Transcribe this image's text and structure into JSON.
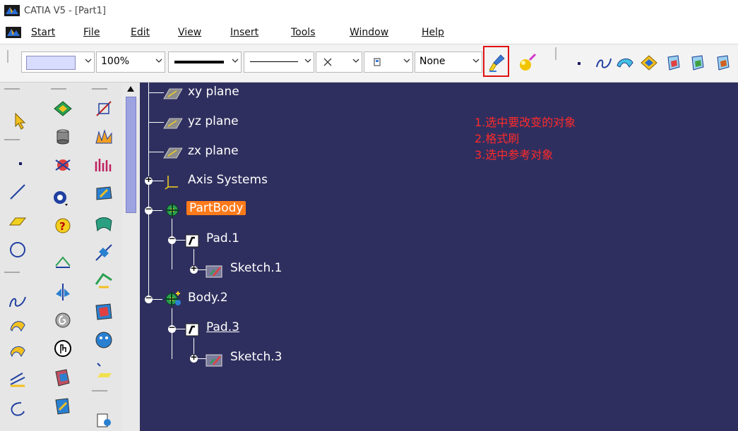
{
  "window": {
    "title": "CATIA V5 - [Part1]"
  },
  "menubar": {
    "items": [
      {
        "label": "Start"
      },
      {
        "label": "File"
      },
      {
        "label": "Edit"
      },
      {
        "label": "View"
      },
      {
        "label": "Insert"
      },
      {
        "label": "Tools"
      },
      {
        "label": "Window"
      },
      {
        "label": "Help"
      }
    ]
  },
  "toolbar": {
    "zoom_value": "100%",
    "layer_value": "None",
    "painter_icon": "format-painter-icon",
    "highlight_color": "#e01010"
  },
  "tree": {
    "nodes": [
      {
        "label": "xy plane"
      },
      {
        "label": "yz plane"
      },
      {
        "label": "zx plane"
      },
      {
        "label": "Axis Systems"
      },
      {
        "label": "PartBody"
      },
      {
        "label": "Pad.1"
      },
      {
        "label": "Sketch.1"
      },
      {
        "label": "Body.2"
      },
      {
        "label": "Pad.3"
      },
      {
        "label": "Sketch.3"
      }
    ]
  },
  "annotation": {
    "lines": [
      "1.选中要改变的对象",
      "2.格式刷",
      "3.选中参考对象"
    ],
    "color": "#ff2a2a"
  },
  "colors": {
    "background": "#2f2f5f",
    "selection": "#ff7a1a"
  }
}
